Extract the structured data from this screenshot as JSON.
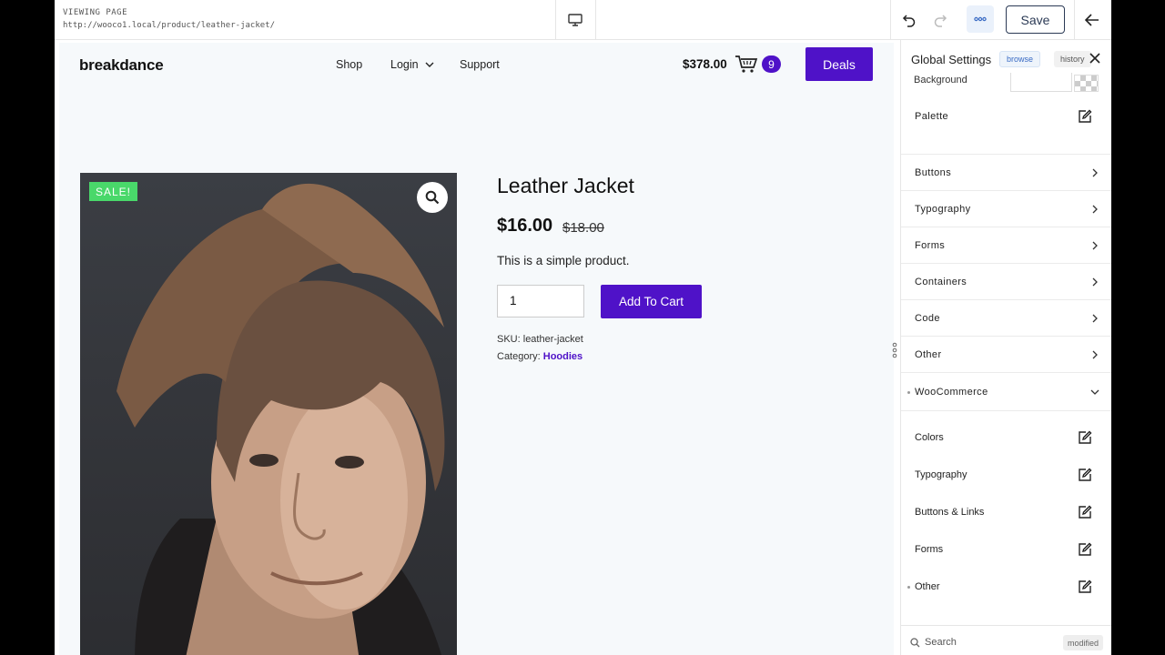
{
  "topbar": {
    "viewing_label": "VIEWING PAGE",
    "url": "http://wooco1.local/product/leather-jacket/",
    "save_label": "Save"
  },
  "site": {
    "logo": "breakdance",
    "nav": [
      "Shop",
      "Login",
      "Support"
    ],
    "cart_total": "$378.00",
    "cart_count": "9",
    "deals_label": "Deals"
  },
  "product": {
    "sale_badge": "SALE!",
    "title": "Leather Jacket",
    "price_now": "$16.00",
    "price_old": "$18.00",
    "short_description": "This is a simple product.",
    "quantity": "1",
    "add_to_cart_label": "Add To Cart",
    "sku_label": "SKU:",
    "sku": "leather-jacket",
    "category_label": "Category:",
    "category": "Hoodies"
  },
  "panel": {
    "title": "Global Settings",
    "browse_label": "browse",
    "history_label": "history",
    "background_label": "Background",
    "palette_label": "Palette",
    "sections": [
      "Buttons",
      "Typography",
      "Forms",
      "Containers",
      "Code",
      "Other",
      "WooCommerce"
    ],
    "woo_items": [
      "Colors",
      "Typography",
      "Buttons & Links",
      "Forms",
      "Other"
    ],
    "search_placeholder": "Search",
    "modified_label": "modified"
  },
  "colors": {
    "accent": "#4f12c8",
    "sale": "#49d86a"
  }
}
